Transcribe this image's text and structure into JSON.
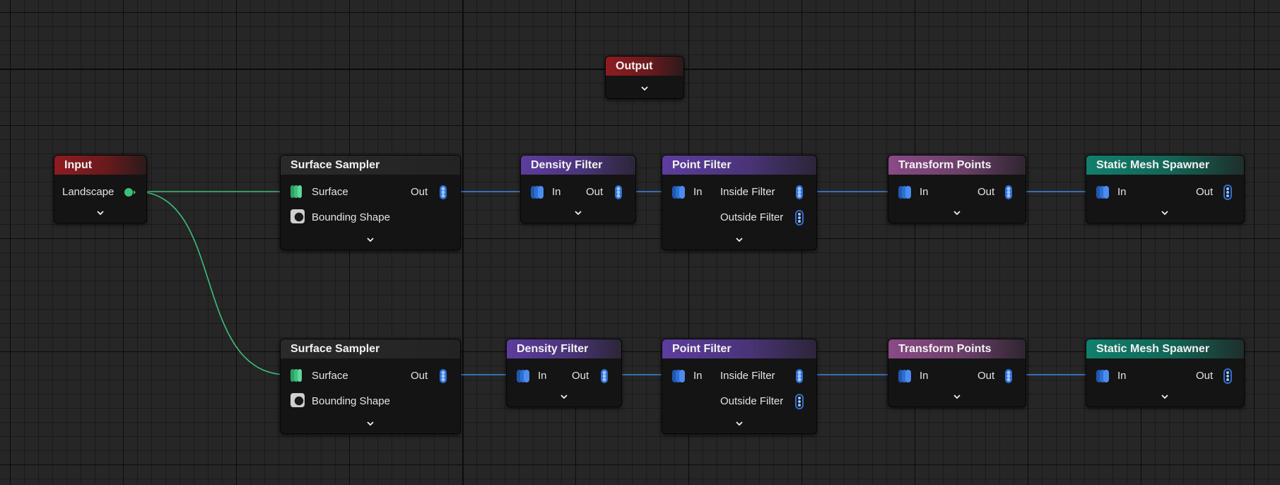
{
  "nodes": {
    "output": {
      "title": "Output"
    },
    "input": {
      "title": "Input",
      "pin_landscape": "Landscape"
    },
    "sampler1": {
      "title": "Surface Sampler",
      "pin_surface": "Surface",
      "pin_bounding": "Bounding Shape",
      "pin_out": "Out"
    },
    "density1": {
      "title": "Density Filter",
      "pin_in": "In",
      "pin_out": "Out"
    },
    "pointfilter1": {
      "title": "Point Filter",
      "pin_in": "In",
      "pin_inside": "Inside Filter",
      "pin_outside": "Outside Filter"
    },
    "transform1": {
      "title": "Transform Points",
      "pin_in": "In",
      "pin_out": "Out"
    },
    "spawner1": {
      "title": "Static Mesh Spawner",
      "pin_in": "In",
      "pin_out": "Out"
    },
    "sampler2": {
      "title": "Surface Sampler",
      "pin_surface": "Surface",
      "pin_bounding": "Bounding Shape",
      "pin_out": "Out"
    },
    "density2": {
      "title": "Density Filter",
      "pin_in": "In",
      "pin_out": "Out"
    },
    "pointfilter2": {
      "title": "Point Filter",
      "pin_in": "In",
      "pin_inside": "Inside Filter",
      "pin_outside": "Outside Filter"
    },
    "transform2": {
      "title": "Transform Points",
      "pin_in": "In",
      "pin_out": "Out"
    },
    "spawner2": {
      "title": "Static Mesh Spawner",
      "pin_in": "In",
      "pin_out": "Out"
    }
  },
  "colors": {
    "canvas": "#262626",
    "wire_points": "#3d86e6",
    "wire_landscape": "#3dbf7a",
    "header_input_output": "#8e1c22",
    "header_sampler": "#2a2a2a",
    "header_filter": "#5d3c9e",
    "header_transform": "#8a4a86",
    "header_spawner": "#127f6d"
  },
  "icons": {
    "points_pin": "stacked-points-icon",
    "surface_pin": "stacked-surface-icon",
    "bounding_pin": "bounding-shape-icon",
    "landscape_pin": "circle-pin-icon",
    "expand": "chevron-down-icon"
  }
}
